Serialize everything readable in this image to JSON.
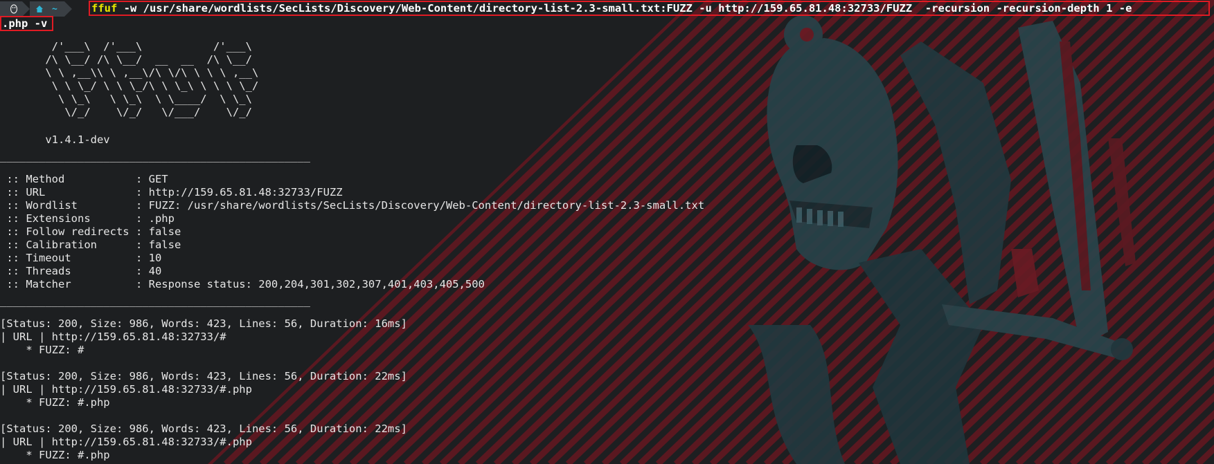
{
  "prompt": {
    "os_icon": "linux-tux-icon",
    "home_icon": "home-icon",
    "directory": "~"
  },
  "command": {
    "program": "ffuf",
    "args": " -w /usr/share/wordlists/SecLists/Discovery/Web-Content/directory-list-2.3-small.txt:FUZZ -u http://159.65.81.48:32733/FUZZ  -recursion -recursion-depth 1 -e",
    "continuation": ".php -v"
  },
  "banner": {
    "ascii": [
      "        /'___\\  /'___\\           /'___\\",
      "       /\\ \\__/ /\\ \\__/  __  __  /\\ \\__/",
      "       \\ \\ ,__\\\\ \\ ,__\\/\\ \\/\\ \\ \\ \\ ,__\\",
      "        \\ \\ \\_/ \\ \\ \\_/\\ \\ \\_\\ \\ \\ \\ \\_/",
      "         \\ \\_\\   \\ \\_\\  \\ \\____/  \\ \\_\\",
      "          \\/_/    \\/_/   \\/___/    \\/_/"
    ],
    "version": "       v1.4.1-dev"
  },
  "separator": "________________________________________________",
  "config": [
    {
      "key": " :: Method           ",
      "value": ": GET"
    },
    {
      "key": " :: URL              ",
      "value": ": http://159.65.81.48:32733/FUZZ"
    },
    {
      "key": " :: Wordlist         ",
      "value": ": FUZZ: /usr/share/wordlists/SecLists/Discovery/Web-Content/directory-list-2.3-small.txt"
    },
    {
      "key": " :: Extensions       ",
      "value": ": .php"
    },
    {
      "key": " :: Follow redirects ",
      "value": ": false"
    },
    {
      "key": " :: Calibration      ",
      "value": ": false"
    },
    {
      "key": " :: Timeout          ",
      "value": ": 10"
    },
    {
      "key": " :: Threads          ",
      "value": ": 40"
    },
    {
      "key": " :: Matcher          ",
      "value": ": Response status: 200,204,301,302,307,401,403,405,500"
    }
  ],
  "results": [
    {
      "status": "[Status: 200, Size: 986, Words: 423, Lines: 56, Duration: 16ms]",
      "url": "| URL | http://159.65.81.48:32733/#",
      "fuzz": "    * FUZZ: #"
    },
    {
      "status": "[Status: 200, Size: 986, Words: 423, Lines: 56, Duration: 22ms]",
      "url": "| URL | http://159.65.81.48:32733/#.php",
      "fuzz": "    * FUZZ: #.php"
    },
    {
      "status": "[Status: 200, Size: 986, Words: 423, Lines: 56, Duration: 22ms]",
      "url": "| URL | http://159.65.81.48:32733/#.php",
      "fuzz": "    * FUZZ: #.php"
    }
  ],
  "colors": {
    "background": "#1d1f21",
    "text": "#e6e6e6",
    "highlight_border": "#e01b24",
    "stripe": "#5a1820",
    "skeleton": "#2a4a52"
  }
}
